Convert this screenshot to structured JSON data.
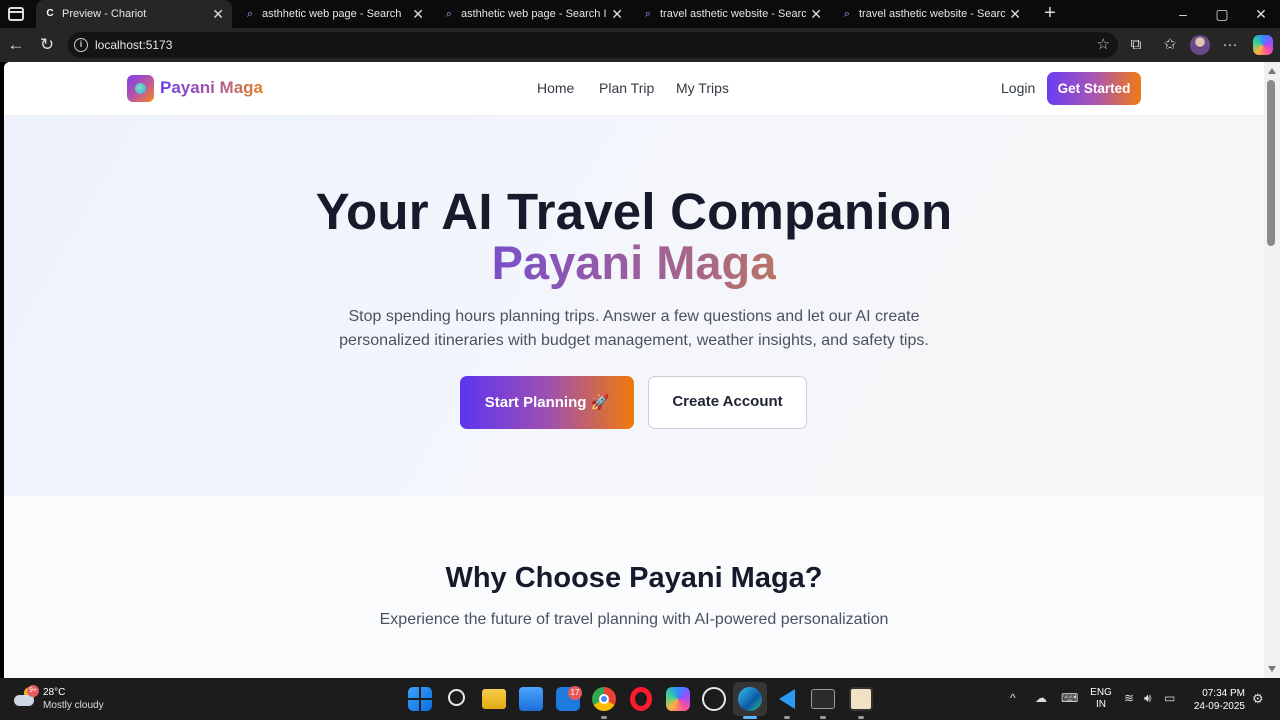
{
  "browser": {
    "tabs": [
      {
        "title": "Preview - Chariot",
        "favicon": "C"
      },
      {
        "title": "asthhetic web page - Search",
        "favicon": "search-icon"
      },
      {
        "title": "asthhetic web page - Search Images",
        "favicon": "search-icon"
      },
      {
        "title": "travel asthetic website - Search",
        "favicon": "search-icon"
      },
      {
        "title": "travel asthetic website - Search Images",
        "favicon": "search-icon"
      }
    ],
    "url": "localhost:5173"
  },
  "site": {
    "brand": "Payani Maga",
    "nav": [
      "Home",
      "Plan Trip",
      "My Trips"
    ],
    "login": "Login",
    "get_started": "Get Started"
  },
  "hero": {
    "title": "Your AI Travel Companion",
    "title_accent": "Payani Maga",
    "subtitle": "Stop spending hours planning trips. Answer a few questions and let our AI create personalized itineraries with budget management, weather insights, and safety tips.",
    "primary_button": "Start Planning 🚀",
    "secondary_button": "Create Account"
  },
  "features": {
    "title": "Why Choose Payani Maga?",
    "subtitle": "Experience the future of travel planning with AI-powered personalization"
  },
  "taskbar": {
    "weather_badge": "9+",
    "temperature": "28°C",
    "condition": "Mostly cloudy",
    "mail_badge": "17",
    "lang_top": "ENG",
    "lang_bottom": "IN",
    "time": "07:34 PM",
    "date": "24-09-2025"
  },
  "colors": {
    "brand_purple": "#6b3df2",
    "brand_orange": "#f07b12",
    "heading": "#161a2b"
  }
}
